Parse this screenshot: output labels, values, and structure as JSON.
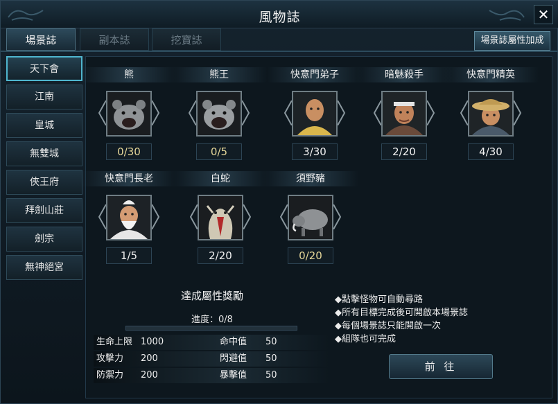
{
  "window": {
    "title": "風物誌",
    "close_label": "✕"
  },
  "tabs": [
    {
      "label": "場景誌",
      "active": true
    },
    {
      "label": "副本誌",
      "active": false
    },
    {
      "label": "挖寶誌",
      "active": false
    }
  ],
  "bonus_button": "場景誌屬性加成",
  "sidebar": [
    {
      "label": "天下會",
      "active": true
    },
    {
      "label": "江南",
      "active": false
    },
    {
      "label": "皇城",
      "active": false
    },
    {
      "label": "無雙城",
      "active": false
    },
    {
      "label": "俠王府",
      "active": false
    },
    {
      "label": "拜劍山莊",
      "active": false
    },
    {
      "label": "劍宗",
      "active": false
    },
    {
      "label": "無神絕宮",
      "active": false
    }
  ],
  "monsters": [
    {
      "name": "熊",
      "count": "0/30",
      "icon": "bear-icon",
      "count_color": "#e7d89a"
    },
    {
      "name": "熊王",
      "count": "0/5",
      "icon": "bear-king-icon",
      "count_color": "#e7d89a"
    },
    {
      "name": "快意門弟子",
      "count": "3/30",
      "icon": "disciple-icon",
      "count_color": "#f2f2f2"
    },
    {
      "name": "暗魅殺手",
      "count": "2/20",
      "icon": "assassin-icon",
      "count_color": "#f2f2f2"
    },
    {
      "name": "快意門精英",
      "count": "4/30",
      "icon": "elite-icon",
      "count_color": "#f2f2f2"
    },
    {
      "name": "快意門長老",
      "count": "1/5",
      "icon": "elder-icon",
      "count_color": "#f2f2f2"
    },
    {
      "name": "白蛇",
      "count": "2/20",
      "icon": "white-snake-icon",
      "count_color": "#f2f2f2"
    },
    {
      "name": "須野豬",
      "count": "0/20",
      "icon": "wild-boar-icon",
      "count_color": "#e7d89a"
    }
  ],
  "reward": {
    "title": "達成屬性獎勵",
    "progress_label": "進度：0/8",
    "progress_fraction": 0
  },
  "stats": [
    {
      "label1": "生命上限",
      "value1": "1000",
      "label2": "命中值",
      "value2": "50"
    },
    {
      "label1": "攻擊力",
      "value1": "200",
      "label2": "閃避值",
      "value2": "50"
    },
    {
      "label1": "防禦力",
      "value1": "200",
      "label2": "暴擊值",
      "value2": "50"
    }
  ],
  "tips": [
    "◆點擊怪物可自動尋路",
    "◆所有目標完成後可開啟本場景誌",
    "◆每個場景誌只能開啟一次",
    "◆組隊也可完成"
  ],
  "goto_button": "前 往"
}
